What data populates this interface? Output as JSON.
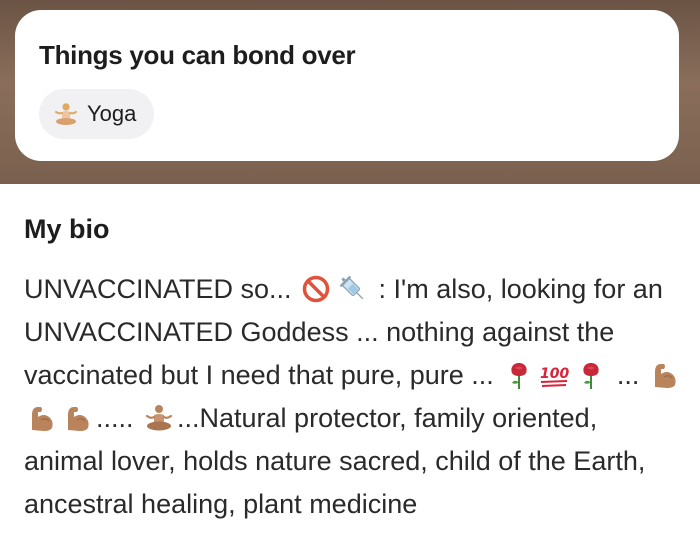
{
  "bond": {
    "title": "Things you can bond over",
    "chips": [
      {
        "label": "Yoga",
        "icon": "meditating-person-icon"
      }
    ]
  },
  "bio": {
    "heading": "My bio",
    "segments": {
      "s1": "UNVACCINATED so... ",
      "s2": " : I'm also, looking for an UNVACCINATED Goddess ... nothing against the vaccinated but I need that pure, pure ... ",
      "s3": " ... ",
      "s4": "..... ",
      "s5": "...Natural protector, family oriented, animal lover, holds nature sacred, child of the Earth, ancestral healing, plant medicine"
    },
    "icons": [
      "no-entry-icon",
      "syringe-icon",
      "rose-icon",
      "hundred-points-icon",
      "rose-icon",
      "flexed-biceps-icon",
      "flexed-biceps-icon",
      "flexed-biceps-icon",
      "meditating-person-icon"
    ]
  },
  "colors": {
    "background_top": "#7a604e",
    "card": "#ffffff",
    "chip": "#f1f1f3",
    "text": "#1d1d1f"
  }
}
